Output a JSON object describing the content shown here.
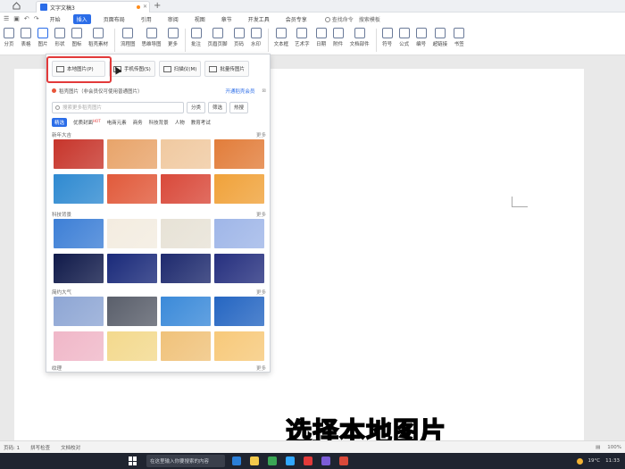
{
  "titlebar": {
    "tab_title": "文字文稿3"
  },
  "menubar": {
    "tabs": [
      "开始",
      "插入",
      "页面布局",
      "引用",
      "审阅",
      "视图",
      "章节",
      "开发工具",
      "会员专享"
    ],
    "active_tab": 1,
    "search": "查找命令",
    "search2": "搜索模板"
  },
  "ribbon": {
    "items": [
      "分页",
      "表格",
      "图片",
      "形状",
      "图标",
      "稻壳素材",
      "流程图",
      "思维导图",
      "更多",
      "批注",
      "页眉页脚",
      "页码",
      "水印",
      "文本框",
      "艺术字",
      "日期",
      "附件",
      "文档部件",
      "符号",
      "公式",
      "编号",
      "超链接",
      "书签"
    ]
  },
  "panel": {
    "options": [
      "本地图片(P)",
      "手机传图(S)",
      "扫描仪(M)",
      "批量传图片"
    ],
    "vip_text": "稻壳图片（非会员仅可使用普通图片）",
    "vip_link": "开通稻壳会员",
    "search_placeholder": "搜索更多稻壳图片",
    "search_btn1": "分类",
    "search_btn2": "筛选",
    "search_btn3": "热搜",
    "categories": [
      "精选",
      "优质封面",
      "电商元素",
      "商务",
      "科技背景",
      "人物",
      "教育考试"
    ],
    "hot_badge": "HOT",
    "sections": [
      {
        "title": "新年大吉",
        "more": "更多"
      },
      {
        "title": "科技背景",
        "more": "更多"
      },
      {
        "title": "简约大气",
        "more": "更多"
      },
      {
        "title": "纹理",
        "more": "更多"
      }
    ],
    "thumb_colors": [
      [
        "#c7352b",
        "#e8a46a",
        "#f0c9a0",
        "#e27d3a"
      ],
      [
        "#2f8ad1",
        "#e15a3b",
        "#d9493a",
        "#f0a23a"
      ],
      [
        "#3d7fd6",
        "#f3ece0",
        "#e7e2d6",
        "#9fb6e8"
      ],
      [
        "#101a4a",
        "#1a2a7a",
        "#1e2a6e",
        "#26307f"
      ],
      [
        "#8ea6d4",
        "#5a5f6b",
        "#3b8ad9",
        "#2566c2"
      ],
      [
        "#f0b7c8",
        "#f3d98d",
        "#f0c27a",
        "#f7c97a"
      ]
    ]
  },
  "caption": "选择本地图片",
  "statusbar": {
    "page": "页码: 1",
    "spell": "拼写检查",
    "proof": "文档校对",
    "zoom": "100%"
  },
  "taskbar": {
    "search": "在这里输入你要搜索的内容",
    "temp": "19°C",
    "time": "11:33"
  }
}
